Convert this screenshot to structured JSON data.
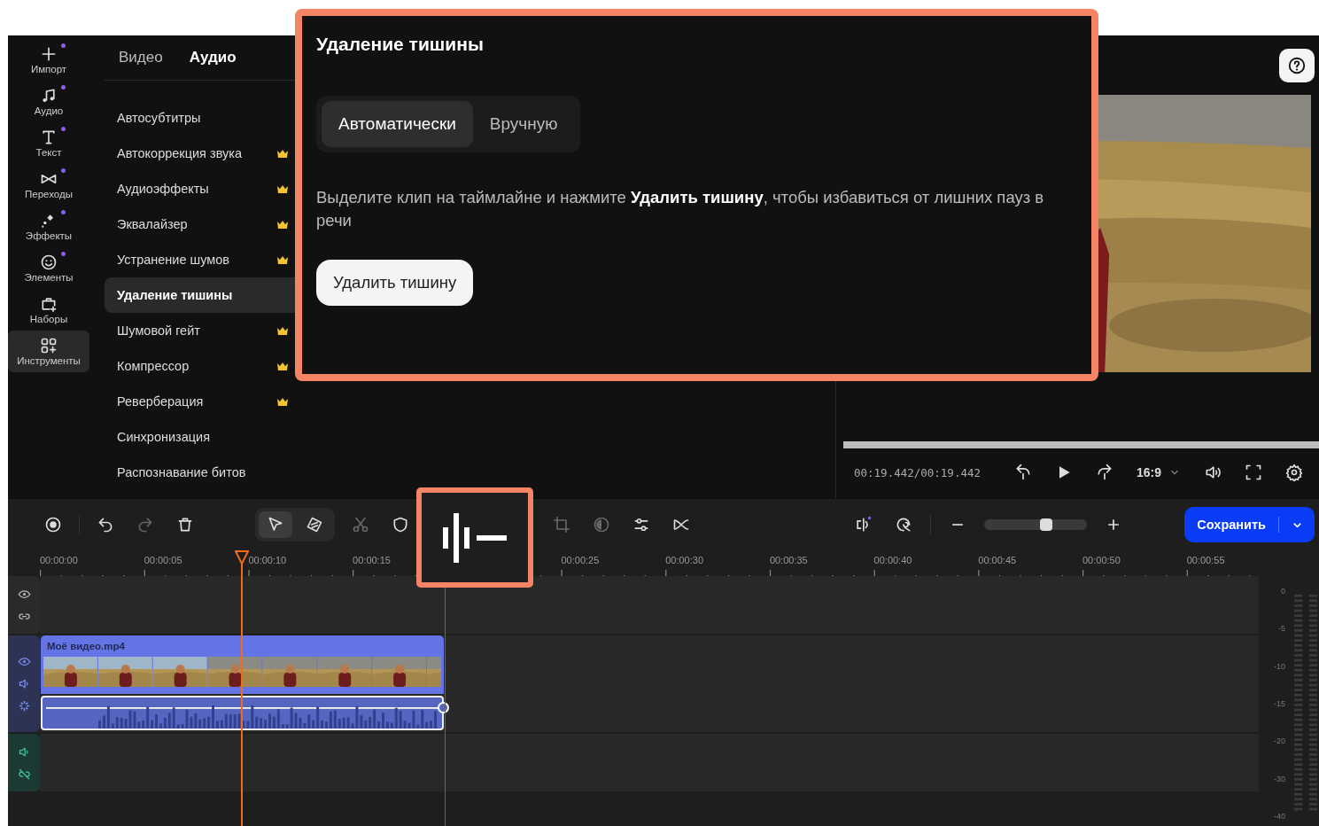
{
  "rail": [
    {
      "kind": "import",
      "label": "Импорт",
      "dot": true,
      "selected": false
    },
    {
      "kind": "audio",
      "label": "Аудио",
      "dot": true,
      "selected": false
    },
    {
      "kind": "text",
      "label": "Текст",
      "dot": true,
      "selected": false
    },
    {
      "kind": "transitions",
      "label": "Переходы",
      "dot": true,
      "selected": false
    },
    {
      "kind": "effects",
      "label": "Эффекты",
      "dot": true,
      "selected": false
    },
    {
      "kind": "elements",
      "label": "Элементы",
      "dot": true,
      "selected": false
    },
    {
      "kind": "kits",
      "label": "Наборы",
      "dot": false,
      "selected": false
    },
    {
      "kind": "tools",
      "label": "Инструменты",
      "dot": false,
      "selected": true
    }
  ],
  "panel": {
    "tabs": [
      {
        "label": "Видео",
        "selected": false
      },
      {
        "label": "Аудио",
        "selected": true
      }
    ],
    "items": [
      {
        "label": "Автосубтитры",
        "premium": false,
        "selected": false
      },
      {
        "label": "Автокоррекция звука",
        "premium": true,
        "selected": false
      },
      {
        "label": "Аудиоэффекты",
        "premium": true,
        "selected": false
      },
      {
        "label": "Эквалайзер",
        "premium": true,
        "selected": false
      },
      {
        "label": "Устранение шумов",
        "premium": true,
        "selected": false
      },
      {
        "label": "Удаление тишины",
        "premium": false,
        "selected": true
      },
      {
        "label": "Шумовой гейт",
        "premium": true,
        "selected": false
      },
      {
        "label": "Компрессор",
        "premium": true,
        "selected": false
      },
      {
        "label": "Реверберация",
        "premium": true,
        "selected": false
      },
      {
        "label": "Синхронизация",
        "premium": false,
        "selected": false
      },
      {
        "label": "Распознавание битов",
        "premium": false,
        "selected": false
      }
    ]
  },
  "popup": {
    "title": "Удаление тишины",
    "modes": [
      {
        "label": "Автоматически",
        "selected": true
      },
      {
        "label": "Вручную",
        "selected": false
      }
    ],
    "description": "Выделите клип на таймлайне и нажмите **Удалить тишину**, чтобы избавиться от лишних пауз в речи",
    "button": "Удалить тишину"
  },
  "preview": {
    "timecode": "00:19.442/00:19.442",
    "aspect": "16:9",
    "progress": {
      "level": 1
    }
  },
  "toolbar": {
    "tools_left": [
      {
        "kind": "record",
        "disabled": false
      },
      {
        "kind": "undo",
        "disabled": false
      },
      {
        "kind": "redo",
        "disabled": true
      },
      {
        "kind": "trash",
        "disabled": false
      }
    ],
    "modes": [
      {
        "kind": "pointer",
        "selected": true
      },
      {
        "kind": "tag",
        "selected": false
      }
    ],
    "tools_mid": [
      {
        "kind": "scissors",
        "disabled": true
      },
      {
        "kind": "shield",
        "disabled": false
      }
    ],
    "tools_right": [
      {
        "kind": "crop",
        "disabled": true
      },
      {
        "kind": "contrast",
        "disabled": true
      },
      {
        "kind": "sliders",
        "disabled": false
      },
      {
        "kind": "bowtie",
        "disabled": false
      }
    ],
    "zoom": {
      "level": 0.6
    },
    "save": "Сохранить"
  },
  "timeline": {
    "ruler": [
      "00:00:00",
      "00:00:05",
      "00:00:10",
      "00:00:15",
      "00:00:25",
      "00:00:30",
      "00:00:35",
      "00:00:40",
      "00:00:45",
      "00:00:50",
      "00:00:55"
    ],
    "clip": {
      "name": "Моё видео.mp4"
    },
    "meter": [
      "0",
      "-5",
      "-10",
      "-15",
      "-20",
      "-30",
      "-40"
    ]
  }
}
